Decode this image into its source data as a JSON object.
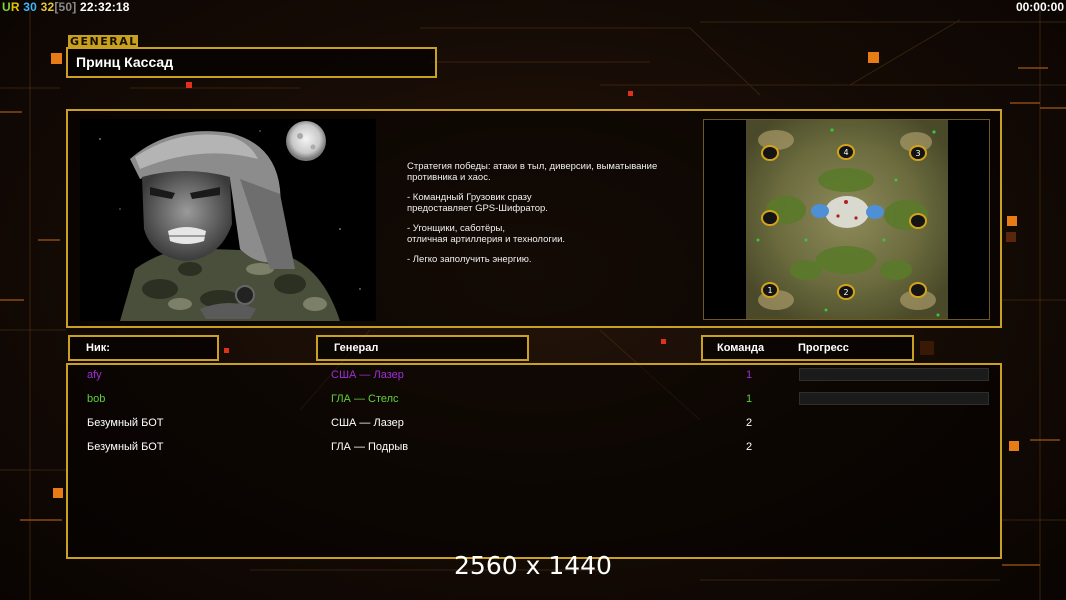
{
  "hud": {
    "ur_u": "U",
    "ur_r": "R",
    "count_a": "30",
    "count_b": "32",
    "count_c": "[50]",
    "clock": "22:32:18",
    "timer": "00:00:00"
  },
  "general": {
    "tag": "GENERAL",
    "name": "Принц Кассад",
    "description": [
      "Стратегия победы: атаки в тыл, диверсии, выматывание\n противника и хаос.",
      "- Командный Грузовик сразу\nпредоставляет GPS-Шифратор.",
      "- Угонщики, саботёры,\nотличная артиллерия и технологии.",
      "- Легко заполучить энергию."
    ],
    "portrait_icon": "soldier-portrait",
    "minimap_icon": "map-preview"
  },
  "map": {
    "start_positions": [
      "1",
      "2",
      "3",
      "4"
    ]
  },
  "table": {
    "headers": {
      "nick": "Ник:",
      "general": "Генерал",
      "team": "Команда",
      "progress": "Прогресс"
    },
    "rows": [
      {
        "nick": "afy",
        "general": "США — Лазер",
        "team": "1",
        "color": "#a02ed8",
        "progress": 0.0,
        "show_progress": true
      },
      {
        "nick": "bob",
        "general": "ГЛА — Стелс",
        "team": "1",
        "color": "#5fd13a",
        "progress": 0.0,
        "show_progress": true
      },
      {
        "nick": "Безумный БОТ",
        "general": "США — Лазер",
        "team": "2",
        "color": "#ffffff",
        "show_progress": false
      },
      {
        "nick": "Безумный БОТ",
        "general": "ГЛА — Подрыв",
        "team": "2",
        "color": "#ffffff",
        "show_progress": false
      }
    ]
  },
  "resolution_text": "2560 x 1440",
  "colors": {
    "frame": "#c9a022",
    "accent_square": "#ff8a1a"
  }
}
